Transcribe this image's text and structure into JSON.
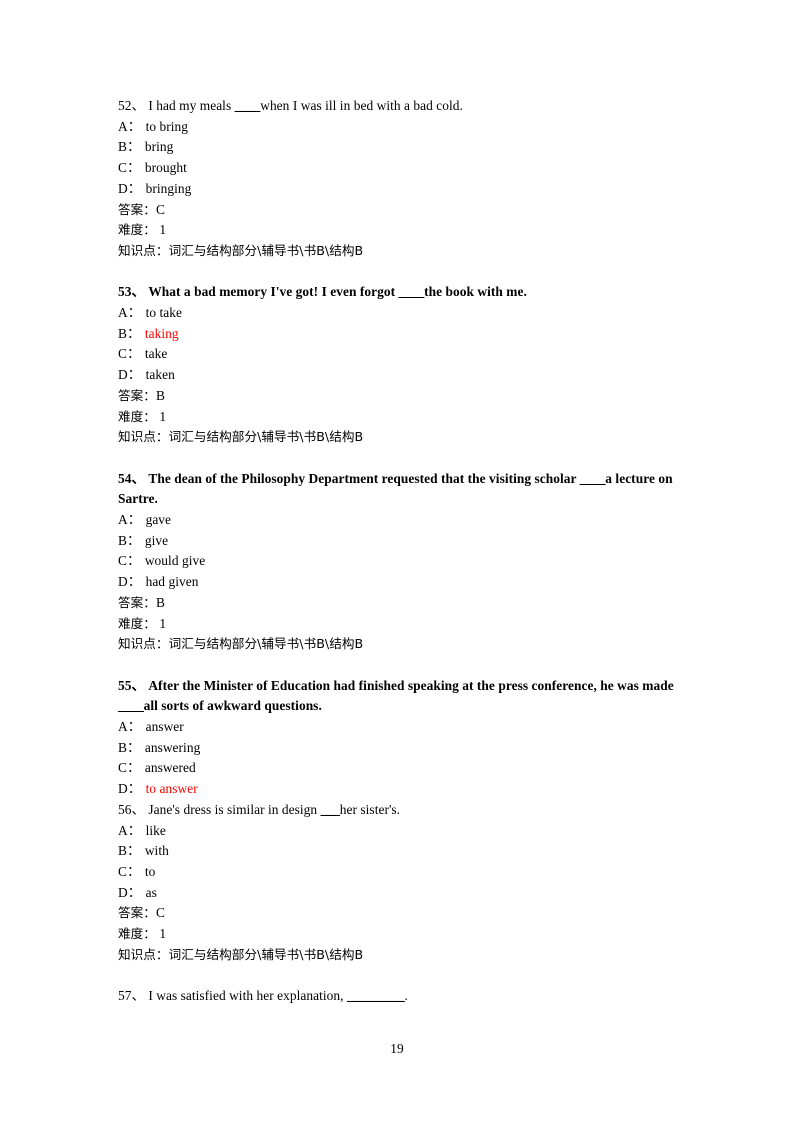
{
  "document": {
    "page_number": "19",
    "labels": {
      "answer": "答案：",
      "difficulty": "难度：",
      "knowledge": "知识点："
    },
    "colors": {
      "text": "#000000",
      "highlight": "#ff0000"
    }
  },
  "questions": [
    {
      "number": "52、",
      "stem_before": "I had my meals ",
      "blank": "____",
      "stem_after": "when I was ill in bed with a bad cold.",
      "bold": false,
      "options": [
        {
          "letter": "A：",
          "text": "to bring",
          "red": false
        },
        {
          "letter": "B：",
          "text": "bring",
          "red": false
        },
        {
          "letter": "C：",
          "text": "brought",
          "red": false
        },
        {
          "letter": "D：",
          "text": "bringing",
          "red": false
        }
      ],
      "answer": "C",
      "difficulty": "1",
      "knowledge": "词汇与结构部分\\辅导书\\书B\\结构B"
    },
    {
      "number": "53、",
      "stem_before": "What a bad memory I've got! I even forgot ",
      "blank": "____",
      "stem_after": "the book with me.",
      "bold": true,
      "options": [
        {
          "letter": "A：",
          "text": "to take",
          "red": false
        },
        {
          "letter": "B：",
          "text": "taking",
          "red": true
        },
        {
          "letter": "C：",
          "text": "take",
          "red": false
        },
        {
          "letter": "D：",
          "text": "taken",
          "red": false
        }
      ],
      "answer": "B",
      "difficulty": "1",
      "knowledge": "词汇与结构部分\\辅导书\\书B\\结构B"
    },
    {
      "number": "54、",
      "stem_before": "The dean of the Philosophy Department requested that the visiting scholar ",
      "blank": "____",
      "stem_after": "a lecture on Sartre.",
      "bold": true,
      "options": [
        {
          "letter": "A：",
          "text": "gave",
          "red": false
        },
        {
          "letter": "B：",
          "text": "give",
          "red": false
        },
        {
          "letter": "C：",
          "text": "would give",
          "red": false
        },
        {
          "letter": "D：",
          "text": "had given",
          "red": false
        }
      ],
      "answer": "B",
      "difficulty": "1",
      "knowledge": "词汇与结构部分\\辅导书\\书B\\结构B"
    },
    {
      "number": "55、",
      "stem_before": "After the Minister of Education had finished speaking at the press conference, he was made ",
      "blank": "____",
      "stem_after": "all sorts of awkward questions.",
      "bold": true,
      "options": [
        {
          "letter": "A：",
          "text": "answer",
          "red": false
        },
        {
          "letter": "B：",
          "text": "answering",
          "red": false
        },
        {
          "letter": "C：",
          "text": "answered",
          "red": false
        },
        {
          "letter": "D：",
          "text": "to answer",
          "red": true
        }
      ],
      "answer": null,
      "difficulty": null,
      "knowledge": null
    },
    {
      "number": "56、",
      "stem_before": "Jane's dress is similar in design ",
      "blank": "___",
      "stem_after": "her sister's.",
      "bold": false,
      "options": [
        {
          "letter": "A：",
          "text": "like",
          "red": false
        },
        {
          "letter": "B：",
          "text": "with",
          "red": false
        },
        {
          "letter": "C：",
          "text": "to",
          "red": false
        },
        {
          "letter": "D：",
          "text": "as",
          "red": false
        }
      ],
      "answer": "C",
      "difficulty": "1",
      "knowledge": "词汇与结构部分\\辅导书\\书B\\结构B"
    },
    {
      "number": "57、",
      "stem_before": "I was satisfied with her explanation, ",
      "blank": "_________",
      "stem_after": ".",
      "bold": false,
      "options": [],
      "answer": null,
      "difficulty": null,
      "knowledge": null
    }
  ]
}
